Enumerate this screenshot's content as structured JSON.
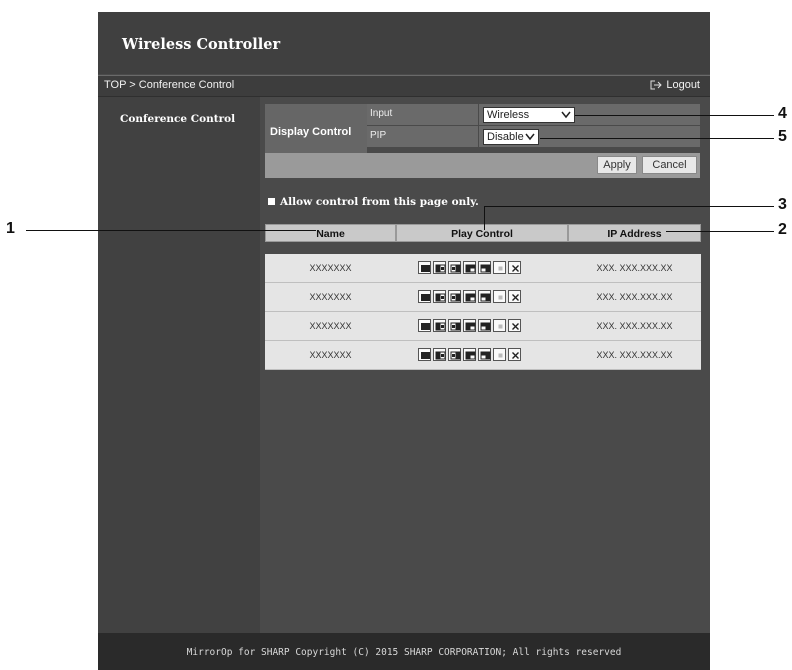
{
  "app": {
    "title": "Wireless Controller"
  },
  "nav": {
    "breadcrumb": "TOP > Conference Control",
    "logout": "Logout"
  },
  "sidebar": {
    "items": [
      {
        "label": "Conference Control"
      }
    ]
  },
  "display_control": {
    "label": "Display Control",
    "input": {
      "label": "Input",
      "value": "Wireless"
    },
    "pip": {
      "label": "PIP",
      "value": "Disable"
    },
    "apply": "Apply",
    "cancel": "Cancel"
  },
  "allow_control": {
    "label": "Allow control from this page only.",
    "checked": true
  },
  "table": {
    "columns": [
      "Name",
      "Play Control",
      "IP Address"
    ],
    "rows": [
      {
        "name": "XXXXXXX",
        "ip": "XXX. XXX.XXX.XX"
      },
      {
        "name": "XXXXXXX",
        "ip": "XXX. XXX.XXX.XX"
      },
      {
        "name": "XXXXXXX",
        "ip": "XXX. XXX.XXX.XX"
      },
      {
        "name": "XXXXXXX",
        "ip": "XXX. XXX.XXX.XX"
      }
    ],
    "play_control_icons": [
      "full-screen-icon",
      "split-left-icon",
      "split-right-icon",
      "quad-bottom-left-icon",
      "quad-bottom-right-icon",
      "stop-icon",
      "disconnect-icon"
    ]
  },
  "callouts": [
    "1",
    "2",
    "3",
    "4",
    "5"
  ],
  "footer": {
    "copyright": "MirrorOp for SHARP Copyright (C) 2015 SHARP CORPORATION; All rights reserved"
  },
  "colors": {
    "header": "#404040",
    "body": "#4a4a4a",
    "table_row": "#e5e5e5",
    "table_header": "#c9c9c9"
  }
}
